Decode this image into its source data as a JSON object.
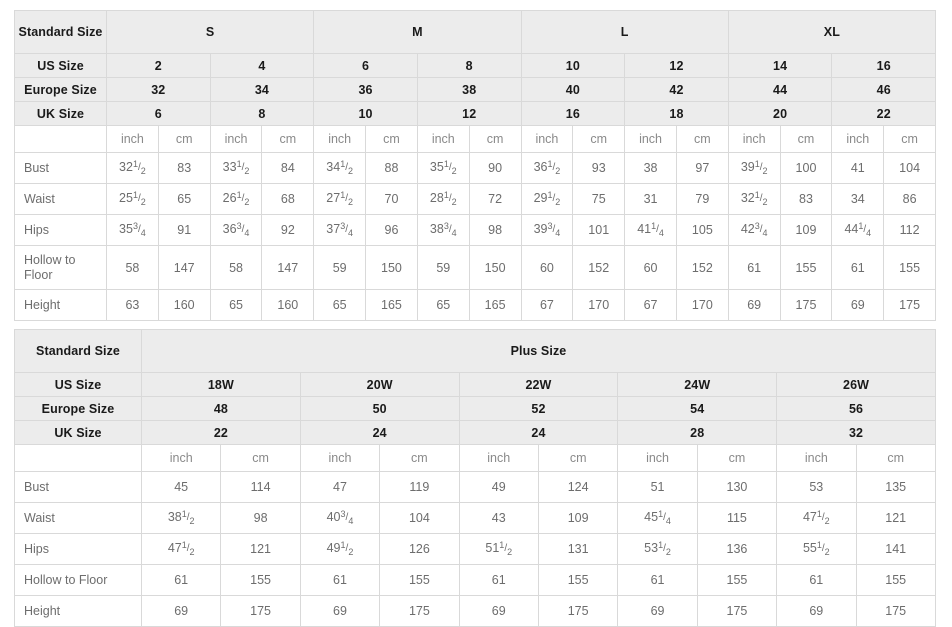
{
  "table1": {
    "row_header_label": "Standard Size",
    "size_groups": [
      {
        "label": "S",
        "span": 2
      },
      {
        "label": "M",
        "span": 2
      },
      {
        "label": "L",
        "span": 2
      },
      {
        "label": "XL",
        "span": 2
      }
    ],
    "us_size_label": "US Size",
    "us_sizes": [
      "2",
      "4",
      "6",
      "8",
      "10",
      "12",
      "14",
      "16"
    ],
    "europe_size_label": "Europe Size",
    "europe_sizes": [
      "32",
      "34",
      "36",
      "38",
      "40",
      "42",
      "44",
      "46"
    ],
    "uk_size_label": "UK Size",
    "uk_sizes": [
      "6",
      "8",
      "10",
      "12",
      "16",
      "18",
      "20",
      "22"
    ],
    "units": [
      "inch",
      "cm",
      "inch",
      "cm",
      "inch",
      "cm",
      "inch",
      "cm",
      "inch",
      "cm",
      "inch",
      "cm",
      "inch",
      "cm",
      "inch",
      "cm"
    ],
    "measurements": [
      {
        "label": "Bust",
        "inch": [
          "32 1/2",
          "33 1/2",
          "34 1/2",
          "35 1/2",
          "36 1/2",
          "38",
          "39 1/2",
          "41"
        ],
        "cm": [
          "83",
          "84",
          "88",
          "90",
          "93",
          "97",
          "100",
          "104"
        ]
      },
      {
        "label": "Waist",
        "inch": [
          "25 1/2",
          "26 1/2",
          "27 1/2",
          "28 1/2",
          "29 1/2",
          "31",
          "32 1/2",
          "34"
        ],
        "cm": [
          "65",
          "68",
          "70",
          "72",
          "75",
          "79",
          "83",
          "86"
        ]
      },
      {
        "label": "Hips",
        "inch": [
          "35 3/4",
          "36 3/4",
          "37 3/4",
          "38 3/4",
          "39 3/4",
          "41 1/4",
          "42 3/4",
          "44 1/4"
        ],
        "cm": [
          "91",
          "92",
          "96",
          "98",
          "101",
          "105",
          "109",
          "112"
        ]
      },
      {
        "label": "Hollow to Floor",
        "label_line1": "Hollow to",
        "label_line2": "Floor",
        "inch": [
          "58",
          "58",
          "59",
          "59",
          "60",
          "60",
          "61",
          "61"
        ],
        "cm": [
          "147",
          "147",
          "150",
          "150",
          "152",
          "152",
          "155",
          "155"
        ]
      },
      {
        "label": "Height",
        "inch": [
          "63",
          "65",
          "65",
          "65",
          "67",
          "67",
          "69",
          "69"
        ],
        "cm": [
          "160",
          "160",
          "165",
          "165",
          "170",
          "170",
          "175",
          "175"
        ]
      }
    ]
  },
  "table2": {
    "row_header_label": "Standard Size",
    "group_label": "Plus Size",
    "us_size_label": "US Size",
    "us_sizes": [
      "18W",
      "20W",
      "22W",
      "24W",
      "26W"
    ],
    "europe_size_label": "Europe Size",
    "europe_sizes": [
      "48",
      "50",
      "52",
      "54",
      "56"
    ],
    "uk_size_label": "UK Size",
    "uk_sizes": [
      "22",
      "24",
      "24",
      "28",
      "32"
    ],
    "units": [
      "inch",
      "cm",
      "inch",
      "cm",
      "inch",
      "cm",
      "inch",
      "cm",
      "inch",
      "cm"
    ],
    "measurements": [
      {
        "label": "Bust",
        "inch": [
          "45",
          "47",
          "49",
          "51",
          "53"
        ],
        "cm": [
          "114",
          "119",
          "124",
          "130",
          "135"
        ]
      },
      {
        "label": "Waist",
        "inch": [
          "38 1/2",
          "40 3/4",
          "43",
          "45 1/4",
          "47 1/2"
        ],
        "cm": [
          "98",
          "104",
          "109",
          "115",
          "121"
        ]
      },
      {
        "label": "Hips",
        "inch": [
          "47 1/2",
          "49 1/2",
          "51 1/2",
          "53 1/2",
          "55 1/2"
        ],
        "cm": [
          "121",
          "126",
          "131",
          "136",
          "141"
        ]
      },
      {
        "label": "Hollow to Floor",
        "inch": [
          "61",
          "61",
          "61",
          "61",
          "61"
        ],
        "cm": [
          "155",
          "155",
          "155",
          "155",
          "155"
        ]
      },
      {
        "label": "Height",
        "inch": [
          "69",
          "69",
          "69",
          "69",
          "69"
        ],
        "cm": [
          "175",
          "175",
          "175",
          "175",
          "175"
        ]
      }
    ]
  },
  "colors": {
    "header_bg": "#ececec",
    "border": "#d9d9d9",
    "header_text": "#1a1a1a",
    "data_text": "#6d6d6d",
    "unit_text": "#8a8a8a",
    "page_bg": "#ffffff"
  }
}
